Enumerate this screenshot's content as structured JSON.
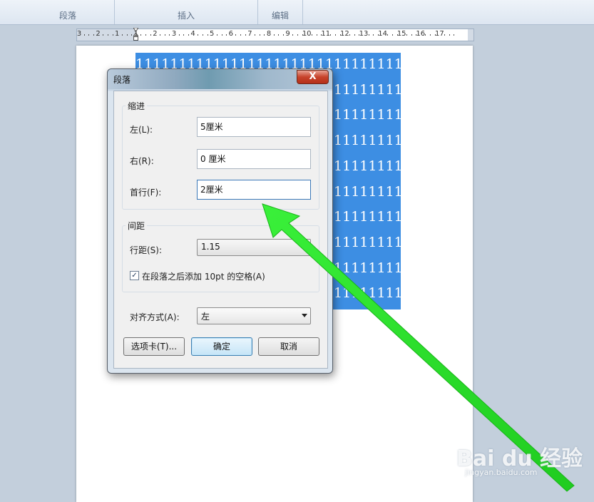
{
  "ribbon": {
    "groups": [
      "段落",
      "插入",
      "编辑"
    ]
  },
  "ruler": {
    "ticks": [
      "3",
      "2",
      "1",
      "1",
      "2",
      "3",
      "4",
      "5",
      "6",
      "7",
      "8",
      "9",
      "10",
      "11",
      "12",
      "13",
      "14",
      "15",
      "16",
      "17"
    ]
  },
  "document": {
    "selected_text_line": "11111111111111111111111111111111111111111111111111",
    "selection_color": "#3d8ee3"
  },
  "dialog": {
    "title": "段落",
    "close_label": "X",
    "indent": {
      "legend": "缩进",
      "left_label": "左(L):",
      "left_value": "5厘米",
      "right_label": "右(R):",
      "right_value": "0 厘米",
      "first_label": "首行(F):",
      "first_value": "2厘米"
    },
    "spacing": {
      "legend": "间距",
      "line_label": "行距(S):",
      "line_value": "1.15",
      "add_space_label": "在段落之后添加 10pt 的空格(A)",
      "add_space_checked": true
    },
    "alignment_label": "对齐方式(A):",
    "alignment_value": "左",
    "buttons": {
      "tabs": "选项卡(T)...",
      "ok": "确定",
      "cancel": "取消"
    }
  },
  "annotation_arrow_color": "#22dd22",
  "watermark": {
    "logo": "Bai du 经验",
    "url": "jingyan.baidu.com"
  }
}
